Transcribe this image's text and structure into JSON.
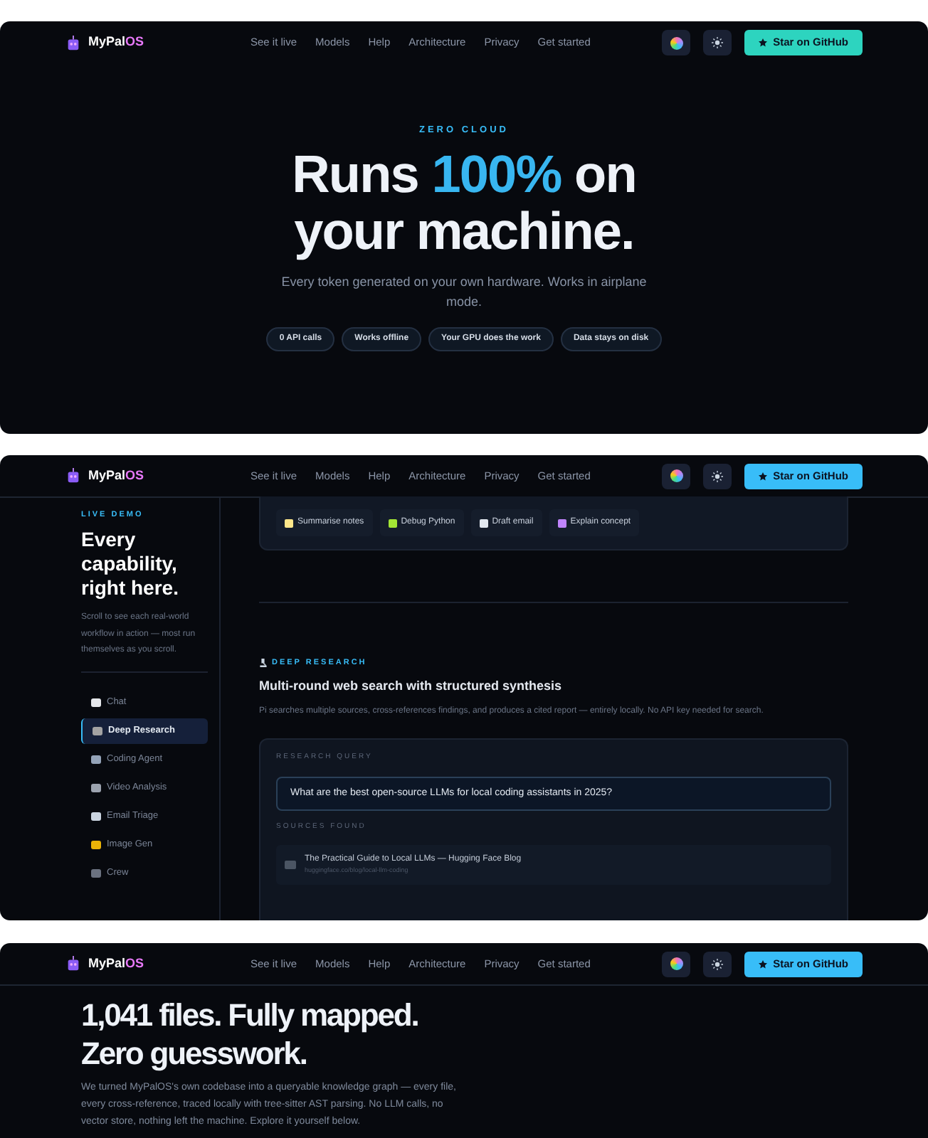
{
  "panels": [
    {
      "kind": "hero",
      "nav": {
        "logo_main": "MyPal",
        "logo_accent": "OS",
        "links": [
          "See it live",
          "Models",
          "Help",
          "Architecture",
          "Privacy",
          "Get started"
        ],
        "cta": {
          "label": "Star on GitHub",
          "color": "#2dd4bf"
        }
      },
      "eyebrow": "ZERO CLOUD",
      "headline": [
        {
          "text": "Runs ",
          "accent": false
        },
        {
          "text": "100%",
          "accent": true
        },
        {
          "text": " on your machine.",
          "accent": false
        }
      ],
      "subtitle": "Every token generated on your own hardware. Works in airplane mode.",
      "pills": [
        "0 API calls",
        "Works offline",
        "Your GPU does the work",
        "Data stays on disk"
      ]
    },
    {
      "kind": "demo",
      "nav": {
        "logo_main": "MyPal",
        "logo_accent": "OS",
        "links": [
          "See it live",
          "Models",
          "Help",
          "Architecture",
          "Privacy",
          "Get started"
        ],
        "cta": {
          "label": "Star on GitHub",
          "color": "#38bdf8"
        }
      },
      "eyebrow": "LIVE DEMO",
      "title": "Every capability, right here.",
      "description": "Scroll to see each real-world workflow in action — most run themselves as you scroll.",
      "items": [
        {
          "label": "Chat",
          "color": "#e5e7eb",
          "selected": false
        },
        {
          "label": "Deep Research",
          "color": "#a3a3a3",
          "selected": true
        },
        {
          "label": "Coding Agent",
          "color": "#94a3b8",
          "selected": false
        },
        {
          "label": "Video Analysis",
          "color": "#9ca3af",
          "selected": false
        },
        {
          "label": "Email Triage",
          "color": "#cbd5e1",
          "selected": false
        },
        {
          "label": "Image Gen",
          "color": "#eab308",
          "selected": false
        },
        {
          "label": "Crew",
          "color": "#6b7280",
          "selected": false
        }
      ],
      "chips": [
        {
          "label": "Summarise notes",
          "color": "#fde68a"
        },
        {
          "label": "Debug Python",
          "color": "#a3e635"
        },
        {
          "label": "Draft email",
          "color": "#e2e8f0"
        },
        {
          "label": "Explain concept",
          "color": "#c084fc"
        }
      ],
      "section_label": "DEEP RESEARCH",
      "section_title": "Multi-round web search with structured synthesis",
      "section_text": "Pi searches multiple sources, cross-references findings, and produces a cited report — entirely locally. No API key needed for search.",
      "query_label": "RESEARCH QUERY",
      "query": "What are the best open-source LLMs for local coding assistants in 2025?",
      "sources_label": "SOURCES FOUND",
      "sources": [
        {
          "title": "The Practical Guide to Local LLMs — Hugging Face Blog",
          "url": "huggingface.co/blog/local-llm-coding"
        }
      ]
    },
    {
      "kind": "graph",
      "nav": {
        "logo_main": "MyPal",
        "logo_accent": "OS",
        "links": [
          "See it live",
          "Models",
          "Help",
          "Architecture",
          "Privacy",
          "Get started"
        ],
        "cta": {
          "label": "Star on GitHub",
          "color": "#38bdf8"
        }
      },
      "title": "1,041 files. Fully mapped. Zero guesswork.",
      "description": "We turned MyPalOS's own codebase into a queryable knowledge graph — every file, every cross-reference, traced locally with tree-sitter AST parsing. No LLM calls, no vector store, nothing left the machine. Explore it yourself below."
    }
  ]
}
